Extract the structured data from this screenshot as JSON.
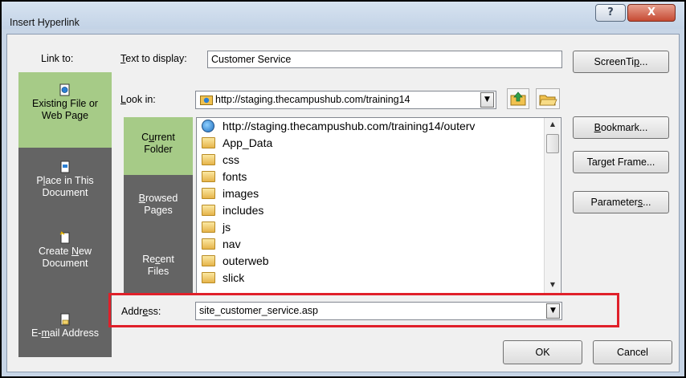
{
  "dialog": {
    "title": "Insert Hyperlink",
    "help_glyph": "?",
    "close_glyph": "X"
  },
  "link_to": {
    "heading": "Link to:",
    "items": [
      {
        "label_a": "Existing File or",
        "label_b": "Web Page",
        "icon": "web-page-icon",
        "selected": true
      },
      {
        "label_a": "Place in This",
        "label_b": "Document",
        "icon": "place-in-document-icon",
        "selected": false
      },
      {
        "label_a": "Create New",
        "label_b": "Document",
        "icon": "new-document-icon",
        "selected": false
      },
      {
        "label_a": "E-mail Address",
        "label_b": "",
        "icon": "email-address-icon",
        "selected": false
      }
    ]
  },
  "text_to_display": {
    "label": "Text to display:",
    "value": "Customer Service"
  },
  "look_in": {
    "label": "Look in:",
    "value": "http://staging.thecampushub.com/training14",
    "up_icon": "up-folder-icon",
    "browse_icon": "browse-folder-icon"
  },
  "look_bar": {
    "items": [
      {
        "label_a": "Current",
        "label_b": "Folder",
        "selected": true
      },
      {
        "label_a": "Browsed",
        "label_b": "Pages",
        "selected": false
      },
      {
        "label_a": "Recent",
        "label_b": "Files",
        "selected": false
      }
    ]
  },
  "files": [
    {
      "name": "http://staging.thecampushub.com/training14/outerv",
      "icon": "web-link-icon"
    },
    {
      "name": "App_Data",
      "icon": "folder-icon"
    },
    {
      "name": "css",
      "icon": "folder-icon"
    },
    {
      "name": "fonts",
      "icon": "folder-icon"
    },
    {
      "name": "images",
      "icon": "folder-icon"
    },
    {
      "name": "includes",
      "icon": "folder-icon"
    },
    {
      "name": "js",
      "icon": "folder-icon"
    },
    {
      "name": "nav",
      "icon": "folder-icon"
    },
    {
      "name": "outerweb",
      "icon": "folder-icon"
    },
    {
      "name": "slick",
      "icon": "folder-icon"
    }
  ],
  "address": {
    "label": "Address:",
    "value": "site_customer_service.asp"
  },
  "buttons": {
    "screentip": "ScreenTip...",
    "bookmark": "Bookmark...",
    "target_frame": "Target Frame...",
    "parameters": "Parameters...",
    "ok": "OK",
    "cancel": "Cancel"
  },
  "colors": {
    "selected_green": "#a6cb87",
    "bar_gray": "#646464",
    "highlight_red": "#e0202a",
    "title_blue": "#c7d5e6"
  }
}
